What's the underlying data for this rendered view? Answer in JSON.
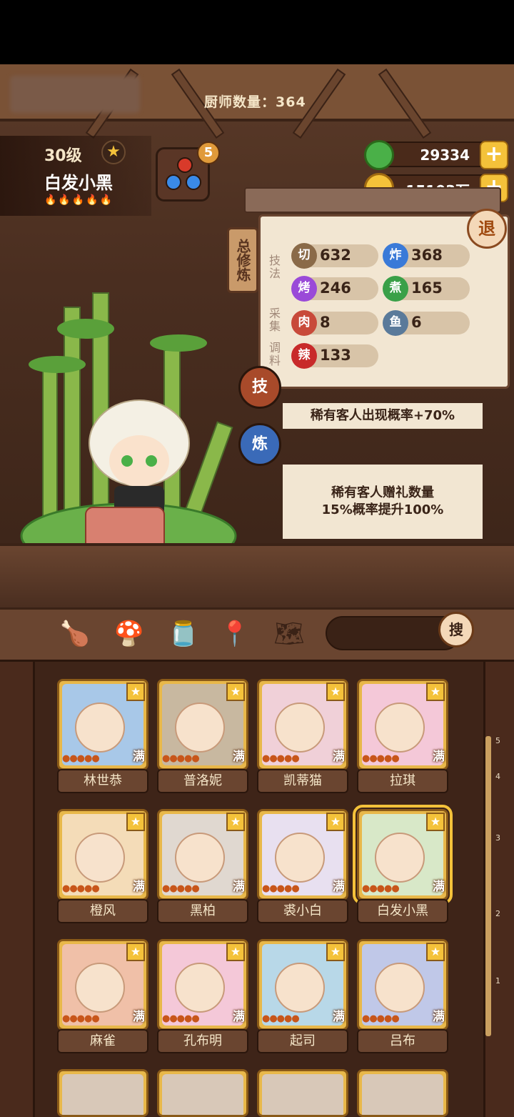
{
  "header": {
    "name_plate_blurred": "",
    "chef_count_label": "厨师数量：",
    "chef_count": "364"
  },
  "currency": {
    "jade": "29334",
    "gold": "15103万"
  },
  "character": {
    "level": "30级",
    "name": "白发小黑",
    "flames": "🔥🔥🔥🔥🔥",
    "gem_badge": "5"
  },
  "cultivation": {
    "tab_label": "总修炼",
    "exit_label": "退",
    "sections": {
      "technique": "技法",
      "gather": "采集",
      "seasoning": "调料"
    },
    "stats": [
      {
        "icon": "切",
        "value": "632",
        "color": "#8a6a48"
      },
      {
        "icon": "炸",
        "value": "368",
        "color": "#3a7ad8"
      },
      {
        "icon": "烤",
        "value": "246",
        "color": "#9a4ad8"
      },
      {
        "icon": "煮",
        "value": "165",
        "color": "#3aa048"
      },
      {
        "icon": "肉",
        "value": "8",
        "color": "#c84a3a"
      },
      {
        "icon": "鱼",
        "value": "6",
        "color": "#5a7a9a"
      },
      {
        "icon": "辣",
        "value": "133",
        "color": "#c82a2a"
      }
    ],
    "skill_tab": "技",
    "refine_tab": "炼",
    "skill_effect": "稀有客人出现概率+70%",
    "refine_effect_line1": "稀有客人赠礼数量",
    "refine_effect_line2": "15%概率提升100%"
  },
  "toolbar": {
    "search_label": "搜",
    "icons": [
      "chicken-leg-icon",
      "mushroom-icon",
      "jar-icon",
      "location-pin-icon",
      "map-help-icon"
    ]
  },
  "chefs": [
    {
      "name": "林世恭",
      "max": "满",
      "bg": "#a8c8e8"
    },
    {
      "name": "普洛妮",
      "max": "满",
      "bg": "#c8b8a0"
    },
    {
      "name": "凯蒂猫",
      "max": "满",
      "bg": "#f0d0d8"
    },
    {
      "name": "拉琪",
      "max": "满",
      "bg": "#f4c8d8"
    },
    {
      "name": "橙风",
      "max": "满",
      "bg": "#f4dcb8"
    },
    {
      "name": "黑柏",
      "max": "满",
      "bg": "#e0d8d0"
    },
    {
      "name": "裘小白",
      "max": "满",
      "bg": "#e8e0f0"
    },
    {
      "name": "白发小黑",
      "max": "满",
      "bg": "#d8e8c8"
    },
    {
      "name": "麻雀",
      "max": "满",
      "bg": "#f0c0a8"
    },
    {
      "name": "孔布明",
      "max": "满",
      "bg": "#f4c8d8"
    },
    {
      "name": "起司",
      "max": "满",
      "bg": "#b8d8e8"
    },
    {
      "name": "吕布",
      "max": "满",
      "bg": "#c0c8e8"
    }
  ],
  "scroll_ticks": [
    "5",
    "4",
    "3",
    "2",
    "1"
  ]
}
